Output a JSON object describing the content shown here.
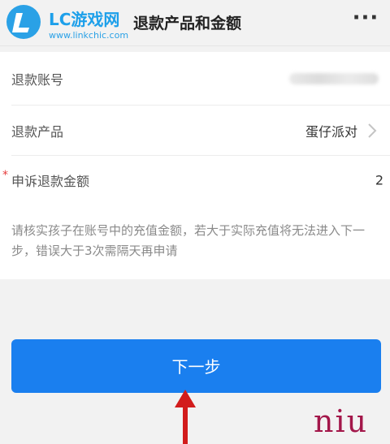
{
  "header": {
    "logo_text": "LC游戏网",
    "logo_url": "www.linkchic.com",
    "title": "退款产品和金额",
    "more_label": "···"
  },
  "form": {
    "account": {
      "label": "退款账号"
    },
    "product": {
      "label": "退款产品",
      "value": "蛋仔派对"
    },
    "amount": {
      "required_mark": "*",
      "label": "申诉退款金额",
      "value": "2"
    }
  },
  "notice": {
    "text": "请核实孩子在账号中的充值金额，若大于实际充值将无法进入下一步，错误大于3次需隔天再申请"
  },
  "actions": {
    "next_label": "下一步"
  },
  "watermark": "niu",
  "colors": {
    "accent": "#1a7fef",
    "brand": "#1ea0ea",
    "required": "#e63c3c",
    "annotation_arrow": "#d21c1c"
  }
}
